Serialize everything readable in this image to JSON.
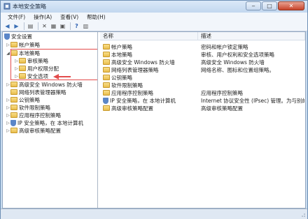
{
  "window": {
    "title": "本地安全策略"
  },
  "menu": [
    {
      "label": "文件(F)"
    },
    {
      "label": "操作(A)"
    },
    {
      "label": "查看(V)"
    },
    {
      "label": "帮助(H)"
    }
  ],
  "tree": {
    "root": "安全设置",
    "items": [
      {
        "label": "帐户策略"
      },
      {
        "label": "本地策略"
      },
      {
        "label": "审核策略"
      },
      {
        "label": "用户权限分配"
      },
      {
        "label": "安全选项"
      },
      {
        "label": "高级安全 Windows 防火墙"
      },
      {
        "label": "网络列表管理器策略"
      },
      {
        "label": "公钥策略"
      },
      {
        "label": "软件限制策略"
      },
      {
        "label": "应用程序控制策略"
      },
      {
        "label": "IP 安全策略，在 本地计算机"
      },
      {
        "label": "高级审核策略配置"
      }
    ]
  },
  "list": {
    "columns": {
      "name": "名称",
      "desc": "描述"
    },
    "rows": [
      {
        "name": "帐户策略",
        "desc": "密码和帐户锁定策略"
      },
      {
        "name": "本地策略",
        "desc": "审核、用户权利和安全选项策略"
      },
      {
        "name": "高级安全 Windows 防火墙",
        "desc": "高级安全 Windows 防火墙"
      },
      {
        "name": "网络列表管理器策略",
        "desc": "网络名称、图标和位置组策略。"
      },
      {
        "name": "公钥策略",
        "desc": ""
      },
      {
        "name": "软件限制策略",
        "desc": ""
      },
      {
        "name": "应用程序控制策略",
        "desc": "应用程序控制策略"
      },
      {
        "name": "IP 安全策略，在 本地计算机",
        "desc": "Internet 协议安全性 (IPsec) 管理。为与别的..."
      },
      {
        "name": "高级审核策略配置",
        "desc": "高级审核策略配置"
      }
    ]
  },
  "colors": {
    "highlight": "#e34b4b",
    "titlebar": "#c2d7ef"
  }
}
